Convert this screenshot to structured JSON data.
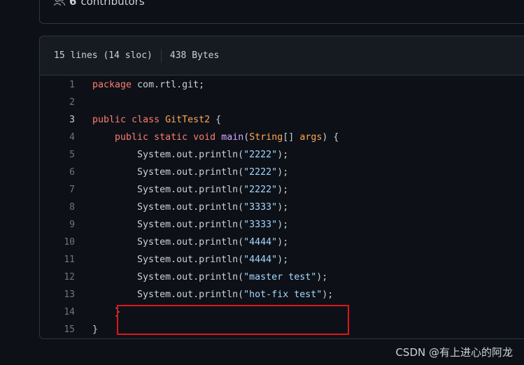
{
  "contributors": {
    "count": "6",
    "label": "contributors"
  },
  "file": {
    "lines_info": "15 lines (14 sloc)",
    "size": "438 Bytes"
  },
  "code_lines": [
    {
      "n": "1",
      "tokens": [
        {
          "t": "package",
          "c": "kw"
        },
        {
          "t": " com.rtl.git;",
          "c": ""
        }
      ]
    },
    {
      "n": "2",
      "tokens": []
    },
    {
      "n": "3",
      "tokens": [
        {
          "t": "public",
          "c": "kw"
        },
        {
          "t": " ",
          "c": ""
        },
        {
          "t": "class",
          "c": "kw"
        },
        {
          "t": " ",
          "c": ""
        },
        {
          "t": "GitTest2",
          "c": "ty"
        },
        {
          "t": " {",
          "c": ""
        }
      ]
    },
    {
      "n": "4",
      "tokens": [
        {
          "t": "    ",
          "c": ""
        },
        {
          "t": "public",
          "c": "kw"
        },
        {
          "t": " ",
          "c": ""
        },
        {
          "t": "static",
          "c": "kw"
        },
        {
          "t": " ",
          "c": ""
        },
        {
          "t": "void",
          "c": "kw"
        },
        {
          "t": " ",
          "c": ""
        },
        {
          "t": "main",
          "c": "fn"
        },
        {
          "t": "(",
          "c": ""
        },
        {
          "t": "String",
          "c": "ty"
        },
        {
          "t": "[] ",
          "c": ""
        },
        {
          "t": "args",
          "c": "ty"
        },
        {
          "t": ") {",
          "c": ""
        }
      ]
    },
    {
      "n": "5",
      "tokens": [
        {
          "t": "        System.out.println(",
          "c": ""
        },
        {
          "t": "\"2222\"",
          "c": "st"
        },
        {
          "t": ");",
          "c": ""
        }
      ]
    },
    {
      "n": "6",
      "tokens": [
        {
          "t": "        System.out.println(",
          "c": ""
        },
        {
          "t": "\"2222\"",
          "c": "st"
        },
        {
          "t": ");",
          "c": ""
        }
      ]
    },
    {
      "n": "7",
      "tokens": [
        {
          "t": "        System.out.println(",
          "c": ""
        },
        {
          "t": "\"2222\"",
          "c": "st"
        },
        {
          "t": ");",
          "c": ""
        }
      ]
    },
    {
      "n": "8",
      "tokens": [
        {
          "t": "        System.out.println(",
          "c": ""
        },
        {
          "t": "\"3333\"",
          "c": "st"
        },
        {
          "t": ");",
          "c": ""
        }
      ]
    },
    {
      "n": "9",
      "tokens": [
        {
          "t": "        System.out.println(",
          "c": ""
        },
        {
          "t": "\"3333\"",
          "c": "st"
        },
        {
          "t": ");",
          "c": ""
        }
      ]
    },
    {
      "n": "10",
      "tokens": [
        {
          "t": "        System.out.println(",
          "c": ""
        },
        {
          "t": "\"4444\"",
          "c": "st"
        },
        {
          "t": ");",
          "c": ""
        }
      ]
    },
    {
      "n": "11",
      "tokens": [
        {
          "t": "        System.out.println(",
          "c": ""
        },
        {
          "t": "\"4444\"",
          "c": "st"
        },
        {
          "t": ");",
          "c": ""
        }
      ]
    },
    {
      "n": "12",
      "tokens": [
        {
          "t": "        System.out.println(",
          "c": ""
        },
        {
          "t": "\"master test\"",
          "c": "st"
        },
        {
          "t": ");",
          "c": ""
        }
      ]
    },
    {
      "n": "13",
      "tokens": [
        {
          "t": "        System.out.println(",
          "c": ""
        },
        {
          "t": "\"hot-fix test\"",
          "c": "st"
        },
        {
          "t": ");",
          "c": ""
        }
      ]
    },
    {
      "n": "14",
      "tokens": [
        {
          "t": "    }",
          "c": ""
        }
      ]
    },
    {
      "n": "15",
      "tokens": [
        {
          "t": "}",
          "c": ""
        }
      ]
    }
  ],
  "active_line": "3",
  "watermark": "CSDN @有上进心的阿龙",
  "colors": {
    "background": "#0d1117",
    "header_bg": "#161b22",
    "keyword": "#ff7b72",
    "type": "#ffa657",
    "function": "#d2a8ff",
    "string": "#a5d6ff",
    "highlight_box": "#e0141b"
  }
}
